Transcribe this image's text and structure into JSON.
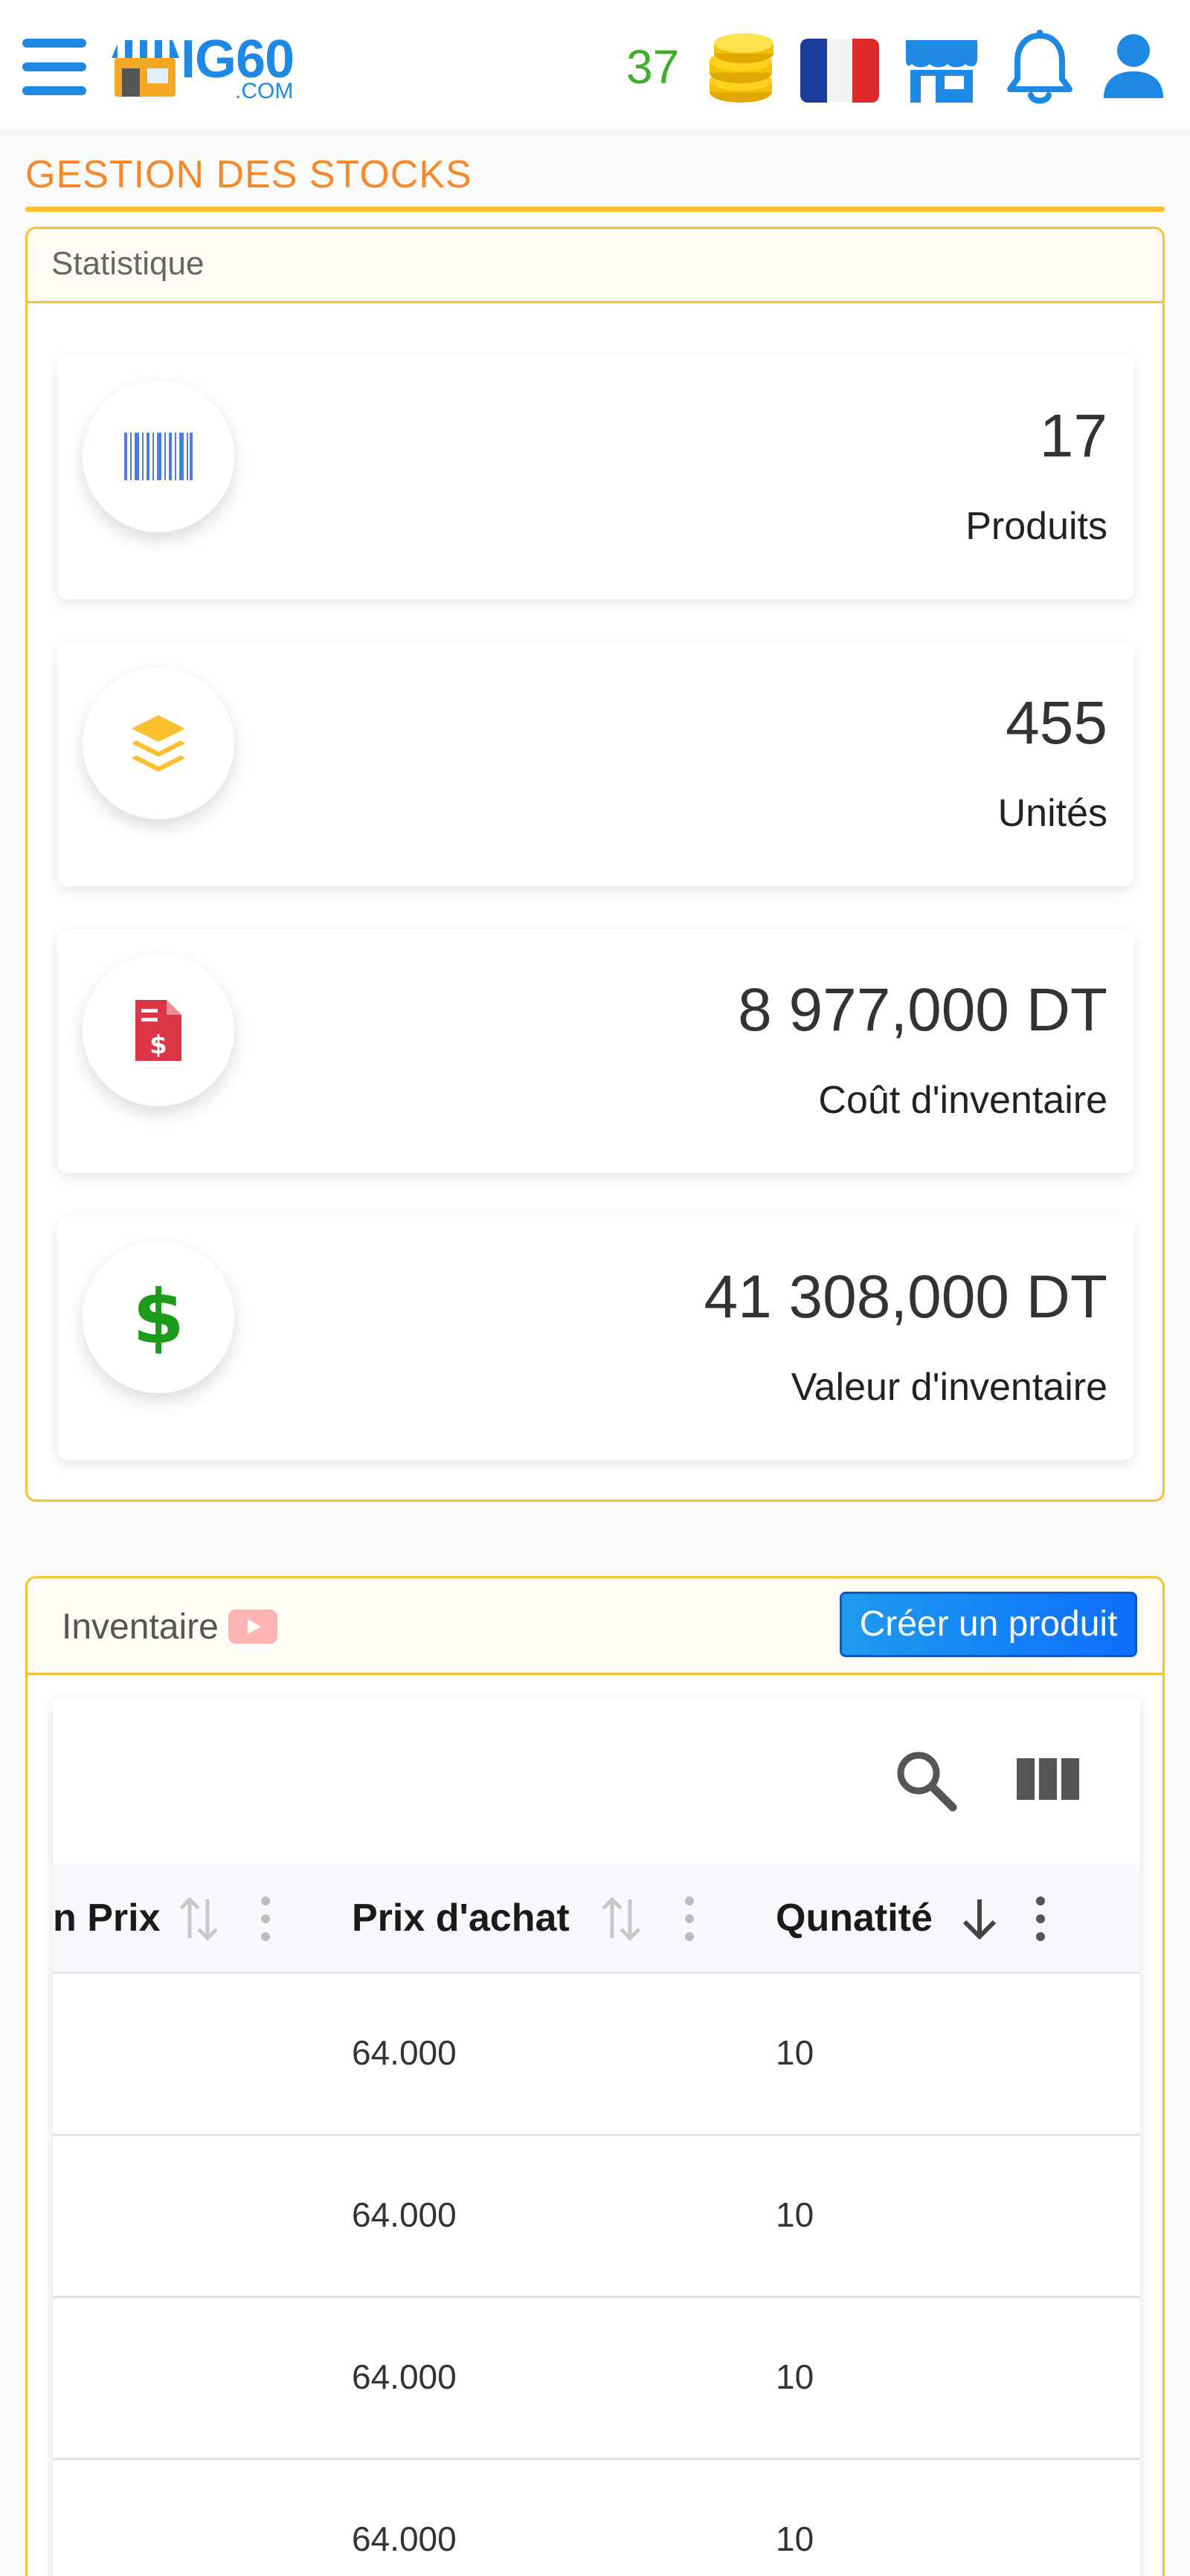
{
  "header": {
    "logo_text": "IG60",
    "logo_sub": ".COM",
    "coins": "37"
  },
  "page": {
    "title": "GESTION DES STOCKS"
  },
  "statistics": {
    "title": "Statistique",
    "items": [
      {
        "value": "17",
        "label": "Produits",
        "icon": "barcode-icon",
        "color": "#4a7de8"
      },
      {
        "value": "455",
        "label": "Unités",
        "icon": "layers-icon",
        "color": "#fbc02d"
      },
      {
        "value": "8 977,000 DT",
        "label": "Coût d'inventaire",
        "icon": "invoice-dollar-icon",
        "color": "#dc3545"
      },
      {
        "value": "41 308,000 DT",
        "label": "Valeur d'inventaire",
        "icon": "dollar-icon",
        "color": "#1a9c1a"
      }
    ]
  },
  "inventory": {
    "title": "Inventaire",
    "create_button": "Créer un produit",
    "columns": [
      {
        "label": "n Prix"
      },
      {
        "label": "Prix d'achat"
      },
      {
        "label": "Qunatité"
      }
    ],
    "rows": [
      {
        "prix": "",
        "prix_achat": "64.000",
        "quantite": "10"
      },
      {
        "prix": "",
        "prix_achat": "64.000",
        "quantite": "10"
      },
      {
        "prix": "",
        "prix_achat": "64.000",
        "quantite": "10"
      },
      {
        "prix": "",
        "prix_achat": "64.000",
        "quantite": "10"
      }
    ]
  },
  "colors": {
    "primary": "#1e88e5",
    "accent": "#f5892a",
    "border": "#fbc02d",
    "coins": "#3fae2a"
  }
}
